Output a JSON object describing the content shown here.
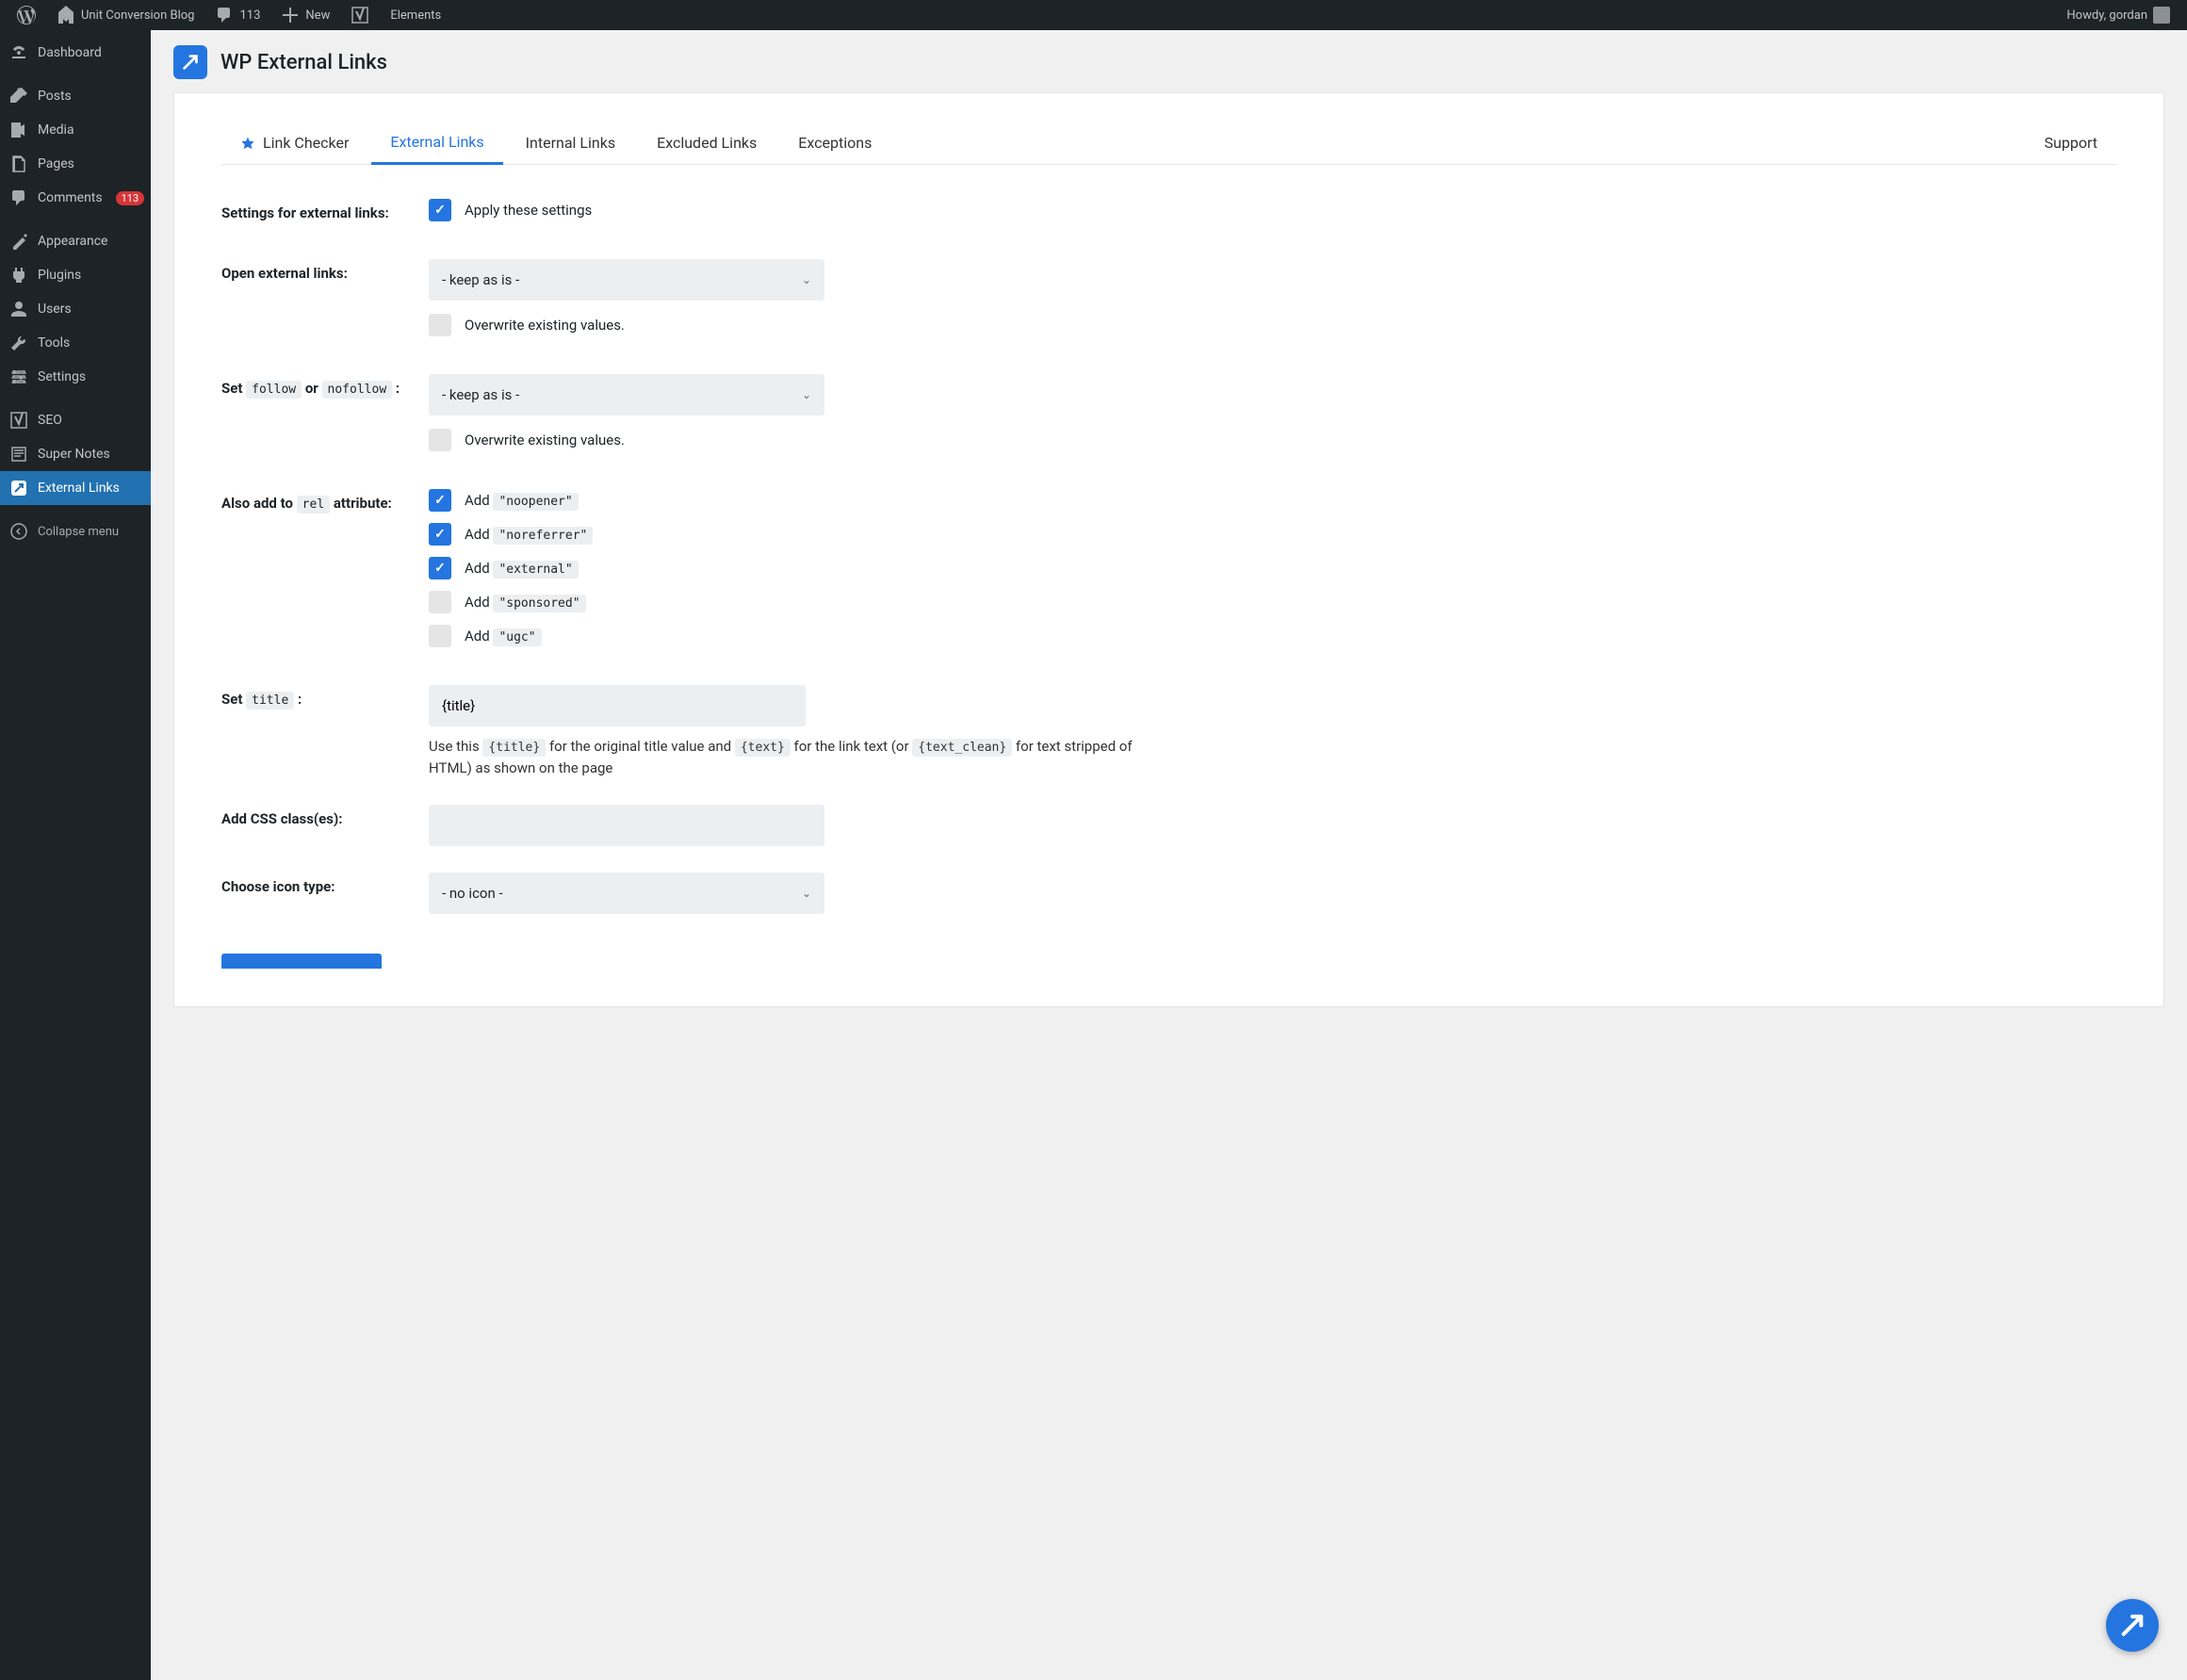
{
  "adminbar": {
    "site_name": "Unit Conversion Blog",
    "comment_count": "113",
    "new_label": "New",
    "elements_label": "Elements",
    "howdy": "Howdy, gordan"
  },
  "adminmenu": {
    "dashboard": "Dashboard",
    "posts": "Posts",
    "media": "Media",
    "pages": "Pages",
    "comments": "Comments",
    "comments_count": "113",
    "appearance": "Appearance",
    "plugins": "Plugins",
    "users": "Users",
    "tools": "Tools",
    "settings": "Settings",
    "seo": "SEO",
    "super_notes": "Super Notes",
    "external_links": "External Links",
    "collapse": "Collapse menu"
  },
  "header": {
    "title": "WP External Links"
  },
  "tabs": {
    "link_checker": "Link Checker",
    "external_links": "External Links",
    "internal_links": "Internal Links",
    "excluded_links": "Excluded Links",
    "exceptions": "Exceptions",
    "support": "Support"
  },
  "form": {
    "settings_label": "Settings for external links:",
    "apply_settings": "Apply these settings",
    "open_label": "Open external links:",
    "keep_as_is": "- keep as is -",
    "overwrite": "Overwrite existing values.",
    "set_follow_pre": "Set ",
    "set_follow_code1": "follow",
    "set_follow_mid": " or ",
    "set_follow_code2": "nofollow",
    "set_follow_post": " :",
    "also_add_pre": "Also add to ",
    "also_add_code": "rel",
    "also_add_post": " attribute:",
    "add_word": "Add ",
    "noopener": "\"noopener\"",
    "noreferrer": "\"noreferrer\"",
    "external": "\"external\"",
    "sponsored": "\"sponsored\"",
    "ugc": "\"ugc\"",
    "set_title_pre": "Set ",
    "set_title_code": "title",
    "set_title_post": " :",
    "title_value": "{title}",
    "hint_1": "Use this ",
    "hint_code1": "{title}",
    "hint_2": " for the original title value and ",
    "hint_code2": "{text}",
    "hint_3": " for the link text (or ",
    "hint_code3": "{text_clean}",
    "hint_4": " for text stripped of HTML) as shown on the page",
    "css_label": "Add CSS class(es):",
    "css_value": "",
    "icon_label": "Choose icon type:",
    "no_icon": "- no icon -"
  }
}
